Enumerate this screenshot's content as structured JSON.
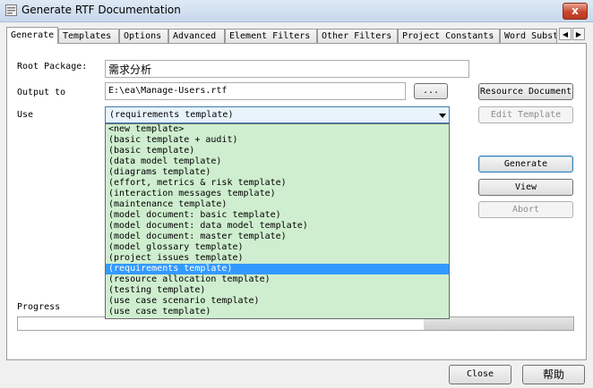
{
  "window": {
    "title": "Generate RTF Documentation",
    "close_label": "x"
  },
  "tabs": [
    {
      "label": "Generate"
    },
    {
      "label": "Templates"
    },
    {
      "label": "Options"
    },
    {
      "label": "Advanced"
    },
    {
      "label": "Element Filters"
    },
    {
      "label": "Other Filters"
    },
    {
      "label": "Project Constants"
    },
    {
      "label": "Word Subst"
    }
  ],
  "form": {
    "root_package_label": "Root Package:",
    "root_package_value": "需求分析",
    "output_label": "Output to",
    "output_value": "E:\\ea\\Manage-Users.rtf",
    "browse_label": "...",
    "use_label": "Use",
    "use_value": "(requirements template)",
    "progress_label": "Progress",
    "progress_fraction": 0.27
  },
  "use_options": [
    "<new template>",
    "(basic template + audit)",
    "(basic template)",
    "(data model template)",
    "(diagrams template)",
    "(effort, metrics & risk template)",
    "(interaction messages template)",
    "(maintenance template)",
    "(model document: basic template)",
    "(model document: data model template)",
    "(model document: master template)",
    "(model glossary template)",
    "(project issues template)",
    "(requirements template)",
    "(resource allocation template)",
    "(testing template)",
    "(use case scenario template)",
    "(use case template)"
  ],
  "selected_option_index": 13,
  "buttons": {
    "resource_document": "Resource Document",
    "edit_template": "Edit Template",
    "generate": "Generate",
    "view": "View",
    "abort": "Abort",
    "close": "Close",
    "help": "帮助"
  },
  "colors": {
    "list_background": "#cfeecf",
    "selection": "#3399ff",
    "close_button": "#c9462c"
  }
}
